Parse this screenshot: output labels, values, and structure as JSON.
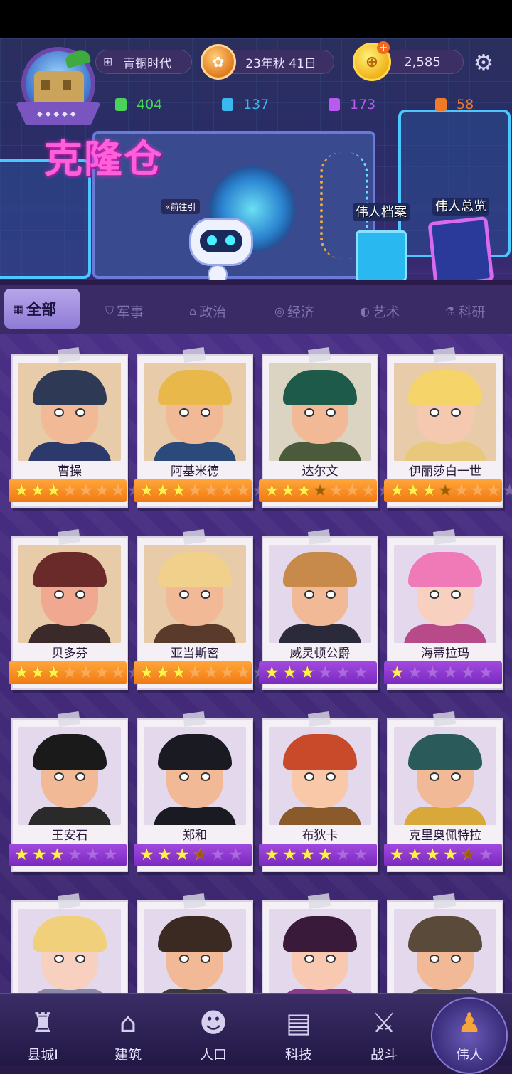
{
  "hud": {
    "era": "青铜时代",
    "date": "23年秋 41日",
    "gold": "2,585",
    "resources": [
      "404",
      "137",
      "173",
      "58"
    ],
    "banner_title": "克隆仓",
    "goto_label": "«前往引",
    "hero_file_label": "伟人档案",
    "hero_overview_label": "伟人总览"
  },
  "tabs": [
    {
      "label": "全部",
      "icon": "grid-icon"
    },
    {
      "label": "军事",
      "icon": "shield-icon"
    },
    {
      "label": "政治",
      "icon": "temple-icon"
    },
    {
      "label": "经济",
      "icon": "coins-icon"
    },
    {
      "label": "艺术",
      "icon": "palette-icon"
    },
    {
      "label": "科研",
      "icon": "flask-icon"
    }
  ],
  "heroes": [
    {
      "name": "曹操",
      "stars": 3,
      "max": 8,
      "bar": "orange",
      "hair": "#2e3a55",
      "skin": "#f2b996",
      "body": "#2b3a6a",
      "bg": "#e8cba8"
    },
    {
      "name": "阿基米德",
      "stars": 3,
      "max": 8,
      "bar": "orange",
      "hair": "#e8b84a",
      "skin": "#f2b996",
      "body": "#2a4a7a",
      "bg": "#e8cba8"
    },
    {
      "name": "达尔文",
      "stars": 3.5,
      "max": 8,
      "bar": "orange",
      "hair": "#1e5a4a",
      "skin": "#f2b996",
      "body": "#4a5a3a",
      "bg": "#dcd4c2"
    },
    {
      "name": "伊丽莎白一世",
      "stars": 3.5,
      "max": 8,
      "bar": "orange",
      "hair": "#f5d46a",
      "skin": "#f5c8b0",
      "body": "#e8c87a",
      "bg": "#e8cba8"
    },
    {
      "name": "贝多芬",
      "stars": 3,
      "max": 8,
      "bar": "orange",
      "hair": "#6a2a2a",
      "skin": "#f0a890",
      "body": "#3a2a2a",
      "bg": "#e8cba8"
    },
    {
      "name": "亚当斯密",
      "stars": 3,
      "max": 8,
      "bar": "orange",
      "hair": "#f0d08a",
      "skin": "#f2b996",
      "body": "#5a3a2a",
      "bg": "#e8cba8"
    },
    {
      "name": "威灵顿公爵",
      "stars": 3,
      "max": 6,
      "bar": "purple",
      "hair": "#c88a4a",
      "skin": "#f2b996",
      "body": "#2a2a3a",
      "bg": "#e4d8ec"
    },
    {
      "name": "海蒂拉玛",
      "stars": 1,
      "max": 6,
      "bar": "purple",
      "hair": "#f07ab8",
      "skin": "#f8d0c0",
      "body": "#b84a8a",
      "bg": "#e4d8ec"
    },
    {
      "name": "王安石",
      "stars": 3,
      "max": 6,
      "bar": "purple",
      "hair": "#1a1a1a",
      "skin": "#f2b996",
      "body": "#2a2a2a",
      "bg": "#e4d8ec"
    },
    {
      "name": "郑和",
      "stars": 3.5,
      "max": 6,
      "bar": "purple",
      "hair": "#1a1a22",
      "skin": "#f2b996",
      "body": "#1a1a22",
      "bg": "#e4d8ec"
    },
    {
      "name": "布狄卡",
      "stars": 4,
      "max": 6,
      "bar": "purple",
      "hair": "#c84a2a",
      "skin": "#f8c8a8",
      "body": "#8a5a2a",
      "bg": "#e4d8ec"
    },
    {
      "name": "克里奥佩特拉",
      "stars": 4.5,
      "max": 6,
      "bar": "purple",
      "hair": "#2a5a5a",
      "skin": "#f2b996",
      "body": "#d8a83a",
      "bg": "#e4d8ec"
    },
    {
      "name": "",
      "stars": 0,
      "max": 0,
      "bar": "none",
      "hair": "#f0d07a",
      "skin": "#f8d0c0",
      "body": "#8a8aa8",
      "bg": "#e4d8ec"
    },
    {
      "name": "",
      "stars": 0,
      "max": 0,
      "bar": "none",
      "hair": "#3a2a22",
      "skin": "#f2b996",
      "body": "#3a3a3a",
      "bg": "#e4d8ec"
    },
    {
      "name": "",
      "stars": 0,
      "max": 0,
      "bar": "none",
      "hair": "#3a1a3a",
      "skin": "#f8c8b0",
      "body": "#8a3a8a",
      "bg": "#e4d8ec"
    },
    {
      "name": "",
      "stars": 0,
      "max": 0,
      "bar": "none",
      "hair": "#5a4a3a",
      "skin": "#f2b996",
      "body": "#4a4a4a",
      "bg": "#e4d8ec"
    }
  ],
  "nav": [
    {
      "label": "县城I",
      "icon": "castle-icon",
      "glyph": "♜"
    },
    {
      "label": "建筑",
      "icon": "house-icon",
      "glyph": "⌂"
    },
    {
      "label": "人口",
      "icon": "person-icon",
      "glyph": "☻"
    },
    {
      "label": "科技",
      "icon": "book-icon",
      "glyph": "▤"
    },
    {
      "label": "战斗",
      "icon": "swords-icon",
      "glyph": "⚔"
    },
    {
      "label": "伟人",
      "icon": "statue-icon",
      "glyph": "♟"
    }
  ]
}
